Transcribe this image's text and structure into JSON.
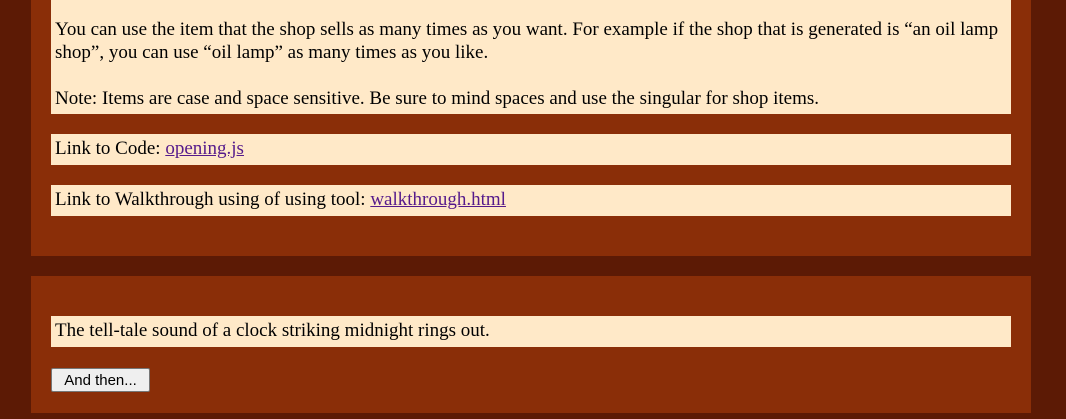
{
  "instructions": {
    "paragraph_1": "You can use the item that the shop sells as many times as you want. For example if the shop that is generated is “an oil lamp shop”, you can use “oil lamp” as many times as you like.",
    "paragraph_2": "Note: Items are case and space sensitive. Be sure to mind spaces and use the singular for shop items."
  },
  "code_link": {
    "label": "Link to Code: ",
    "link_text": "opening.js"
  },
  "walkthrough_link": {
    "label": "Link to Walkthrough using of using tool: ",
    "link_text": "walkthrough.html"
  },
  "story": {
    "text": "The tell-tale sound of a clock striking midnight rings out.",
    "button_label": "And then..."
  },
  "colors": {
    "page_background": "#5c1a05",
    "section_background": "#8a2e08",
    "panel_background": "#ffe9c8",
    "link": "#551a8b"
  }
}
